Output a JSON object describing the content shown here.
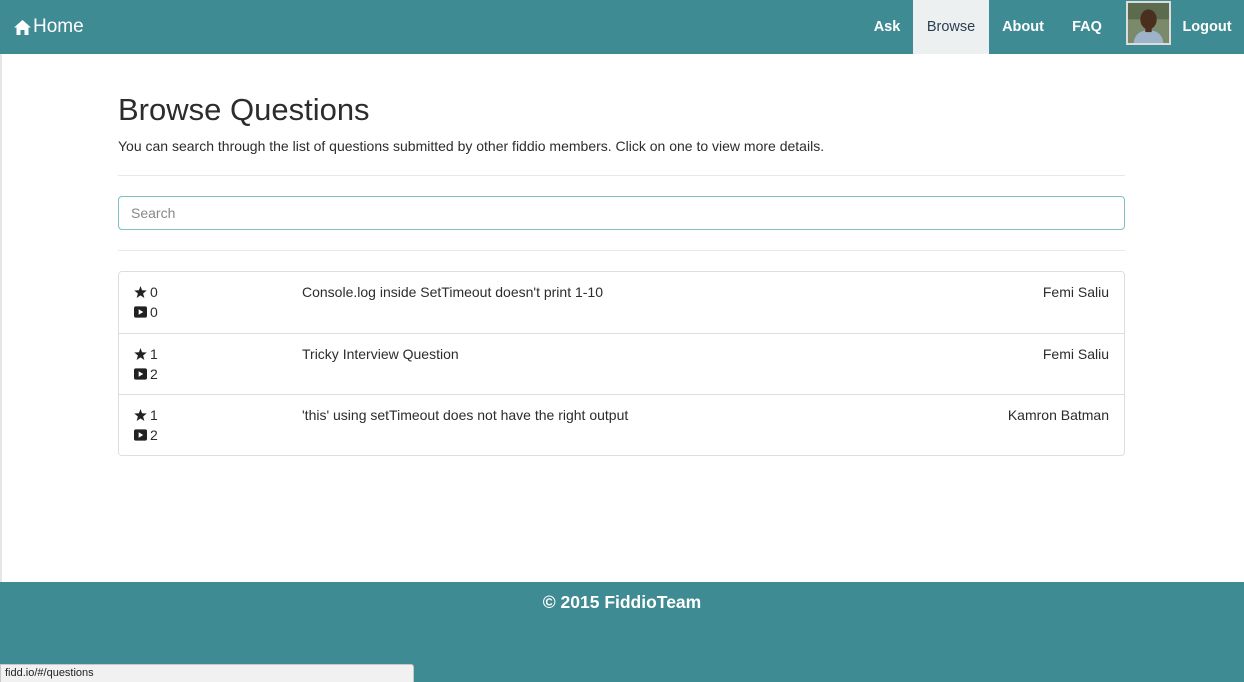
{
  "navbar": {
    "brand_label": "Home",
    "items": [
      {
        "label": "Ask"
      },
      {
        "label": "Browse"
      },
      {
        "label": "About"
      },
      {
        "label": "FAQ"
      },
      {
        "label": "Logout"
      }
    ],
    "active_item": "Browse",
    "avatar_icon": "user-avatar"
  },
  "main": {
    "title": "Browse Questions",
    "description": "You can search through the list of questions submitted by other fiddio members. Click on one to view more details.",
    "search": {
      "placeholder": "Search",
      "value": ""
    },
    "questions": [
      {
        "stars": "0",
        "videos": "0",
        "title": "Console.log inside SetTimeout doesn't print 1-10",
        "author": "Femi Saliu"
      },
      {
        "stars": "1",
        "videos": "2",
        "title": "Tricky Interview Question",
        "author": "Femi Saliu"
      },
      {
        "stars": "1",
        "videos": "2",
        "title": "'this' using setTimeout does not have the right output",
        "author": "Kamron Batman"
      }
    ]
  },
  "footer": {
    "text": "© 2015 FiddioTeam"
  },
  "status_bar": {
    "url": "fidd.io/#/questions"
  },
  "colors": {
    "brand": "#3f8b93",
    "active_nav_bg": "#ecf0f1",
    "text": "#2c2c2c"
  },
  "icons": [
    "home-icon",
    "star-icon",
    "video-icon"
  ]
}
